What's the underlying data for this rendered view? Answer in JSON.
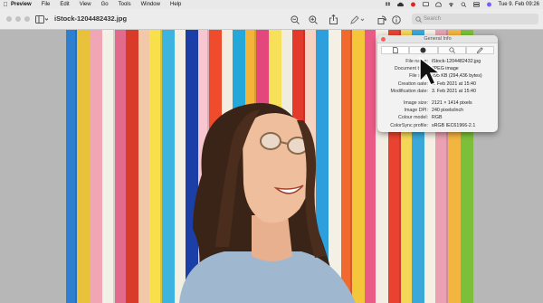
{
  "menubar": {
    "items": [
      "Preview",
      "File",
      "Edit",
      "View",
      "Go",
      "Tools",
      "Window",
      "Help"
    ],
    "clock": "Tue 9. Feb 09:26"
  },
  "window": {
    "title": "iStock-1204482432.jpg",
    "search_placeholder": "Search"
  },
  "inspector": {
    "title": "General Info",
    "rows_top": [
      {
        "key": "File name:",
        "value": "iStock-1204482432.jpg"
      },
      {
        "key": "Document type:",
        "value": "JPEG image"
      },
      {
        "key": "File size:",
        "value": "295 KB (294,436 bytes)"
      },
      {
        "key": "Creation date:",
        "value": "3. Feb 2021 at 15:40"
      },
      {
        "key": "Modification date:",
        "value": "3. Feb 2021 at 15:40"
      }
    ],
    "rows_bottom": [
      {
        "key": "Image size:",
        "value": "2121 × 1414 pixels"
      },
      {
        "key": "Image DPI:",
        "value": "240 pixels/inch"
      },
      {
        "key": "Colour model:",
        "value": "RGB"
      },
      {
        "key": "ColorSync profile:",
        "value": "sRGB IEC61966-2.1"
      }
    ]
  },
  "colors": {
    "accent": "#0a84ff",
    "close": "#ff5f57",
    "minimize": "#febc2e",
    "zoom": "#28c840"
  }
}
